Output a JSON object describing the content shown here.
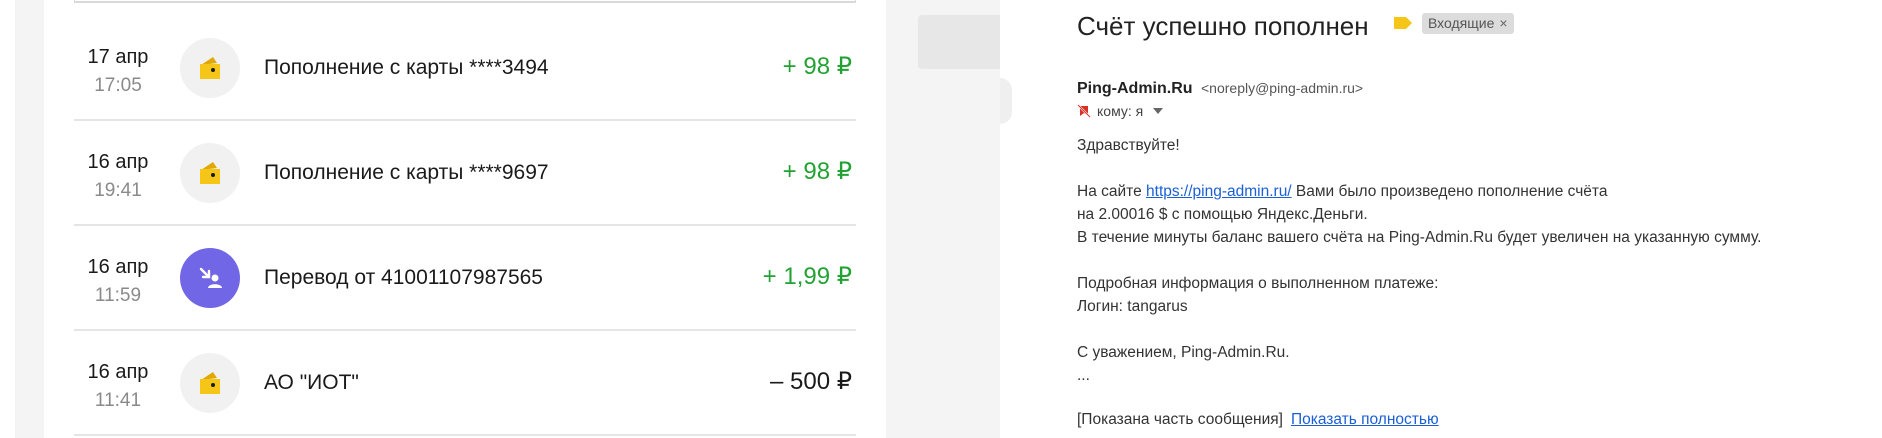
{
  "wallet": {
    "transactions": [
      {
        "date": "17 апр",
        "time": "17:05",
        "title": "Пополнение с карты ****3494",
        "amount": "+ 98 ₽",
        "kind": "positive",
        "icon": "wallet-icon"
      },
      {
        "date": "16 апр",
        "time": "19:41",
        "title": "Пополнение с карты ****9697",
        "amount": "+ 98 ₽",
        "kind": "positive",
        "icon": "wallet-icon"
      },
      {
        "date": "16 апр",
        "time": "11:59",
        "title": "Перевод от 41001107987565",
        "amount": "+ 1,99 ₽",
        "kind": "positive",
        "icon": "incoming-transfer-icon"
      },
      {
        "date": "16 апр",
        "time": "11:41",
        "title": "АО \"ИОТ\"",
        "amount": "– 500 ₽",
        "kind": "negative",
        "icon": "wallet-icon"
      }
    ],
    "colors": {
      "positive": "#22a232",
      "transfer_icon_bg": "#7167e6",
      "wallet_yellow": "#f5c518"
    }
  },
  "mail": {
    "subject": "Счёт успешно пополнен",
    "folder_chip": "Входящие",
    "folder_chip_close": "×",
    "sender_name": "Ping-Admin.Ru",
    "sender_email": "<noreply@ping-admin.ru>",
    "recipient": "кому: я",
    "body": {
      "greeting": "Здравствуйте!",
      "line1_prefix": "На сайте ",
      "line1_link": "https://ping-admin.ru/",
      "line1_suffix": " Вами было произведено пополнение счёта",
      "line2": "на 2.00016 $ с помощью Яндекс.Деньги.",
      "line3": "В течение минуты баланс вашего счёта на Ping-Admin.Ru будет увеличен на указанную сумму.",
      "info_header": "Подробная информация о выполненном платеже:",
      "login_line": "Логин: tangarus",
      "regards": "С уважением, Ping-Admin.Ru.",
      "ellipsis": "..."
    },
    "footer": {
      "partial_notice": "[Показана часть сообщения]",
      "show_full_link": "Показать полностью"
    },
    "colors": {
      "link": "#1a5fd6",
      "label": "#f5c518",
      "chip_bg": "#dcdcdc"
    }
  }
}
